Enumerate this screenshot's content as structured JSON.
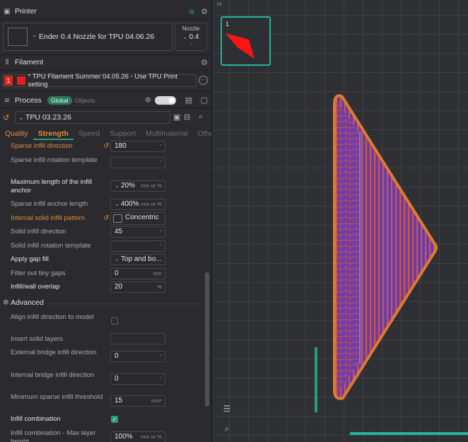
{
  "printer": {
    "header": "Printer",
    "name": "Ender 0.4 Nozzle for TPU 04.06.26",
    "nozzle_label": "Nozzle",
    "nozzle_value": "0.4",
    "nozzle_dash": "-"
  },
  "filament": {
    "header": "Filament",
    "index": "1",
    "name": "* TPU Filament Summer 04.05.26 - Use TPU Print setting",
    "color": "#e02020"
  },
  "process": {
    "header": "Process",
    "global_label": "Global",
    "objects_label": "Objects",
    "preset": "TPU 03.23.26"
  },
  "tabs": [
    {
      "label": "Quality"
    },
    {
      "label": "Strength"
    },
    {
      "label": "Speed"
    },
    {
      "label": "Support"
    },
    {
      "label": "Multimaterial"
    },
    {
      "label": "Others"
    }
  ],
  "params": {
    "sparse_dir_label": "Sparse infill direction",
    "sparse_dir_value": "180",
    "sparse_rot_label": "Sparse infill rotation template",
    "max_len_label": "Maximum length of the infill anchor",
    "max_len_value": "20%",
    "max_len_unit": "mm or %",
    "anchor_len_label": "Sparse infill anchor length",
    "anchor_len_value": "400%",
    "anchor_len_unit": "mm or %",
    "internal_pattern_label": "Internal solid infill pattern",
    "internal_pattern_value": "Concentric",
    "solid_dir_label": "Solid infill direction",
    "solid_dir_value": "45",
    "solid_rot_label": "Solid infill rotation template",
    "gap_fill_label": "Apply gap fill",
    "gap_fill_value": "Top and bo...",
    "tiny_gaps_label": "Filter out tiny gaps",
    "tiny_gaps_value": "0",
    "tiny_gaps_unit": "mm",
    "overlap_label": "Infill/wall overlap",
    "overlap_value": "20",
    "overlap_unit": "%"
  },
  "advanced": {
    "header": "Advanced",
    "align_label": "Align infill direction to model",
    "insert_solid_label": "Insert solid layers",
    "ext_bridge_label": "External bridge infill direction",
    "ext_bridge_value": "0",
    "int_bridge_label": "Internal bridge infill direction",
    "int_bridge_value": "0",
    "min_sparse_label": "Minimum sparse infill threshold",
    "min_sparse_value": "15",
    "min_sparse_unit": "mm²",
    "combination_label": "Infill combination",
    "combo_max_label": "Infill combination - Max layer height",
    "combo_max_value": "100%",
    "combo_max_unit": "mm or %"
  },
  "viewport": {
    "plate_number": "1"
  },
  "colors": {
    "accent_orange": "#e08a3c",
    "accent_green": "#2a9d75",
    "object_outline": "#e07a30",
    "object_fill": "#6a3aa8"
  }
}
